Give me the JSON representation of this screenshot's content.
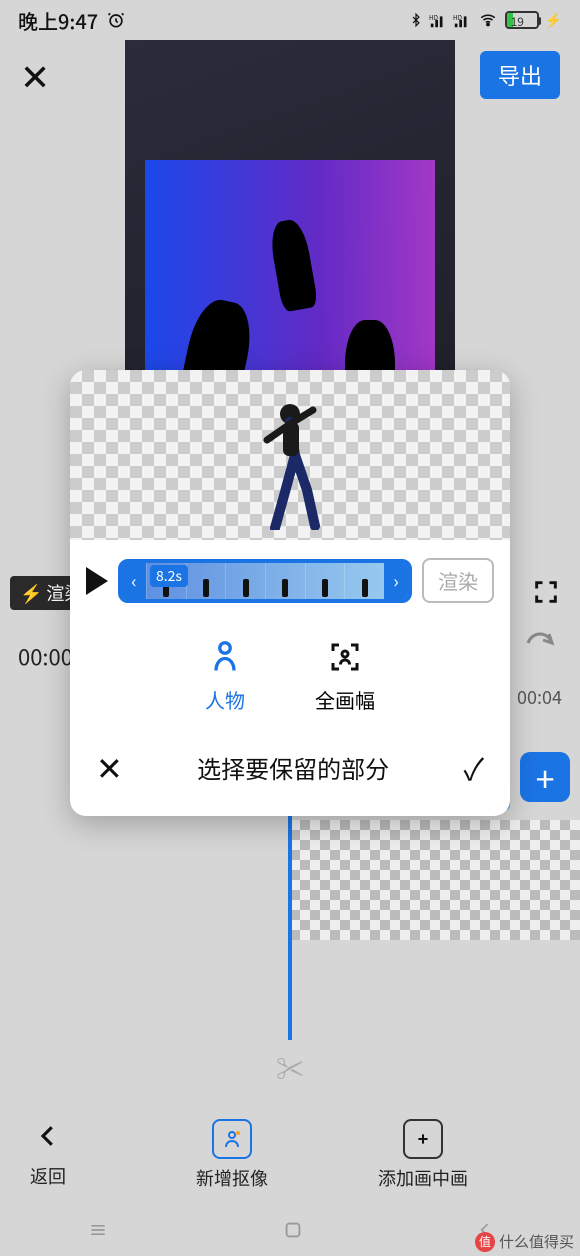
{
  "status": {
    "time": "晚上9:47",
    "battery_pct": "19"
  },
  "appbar": {
    "export_label": "导出"
  },
  "render_chip": "渲染",
  "timeline": {
    "time_left": "00:00",
    "time_right": "00:04"
  },
  "bottom": {
    "back": "返回",
    "cutout": "新增抠像",
    "pip": "添加画中画"
  },
  "modal": {
    "clip_duration": "8.2s",
    "render_btn": "渲染",
    "mode_person": "人物",
    "mode_full": "全画幅",
    "footer_title": "选择要保留的部分"
  },
  "watermark": "什么值得买"
}
